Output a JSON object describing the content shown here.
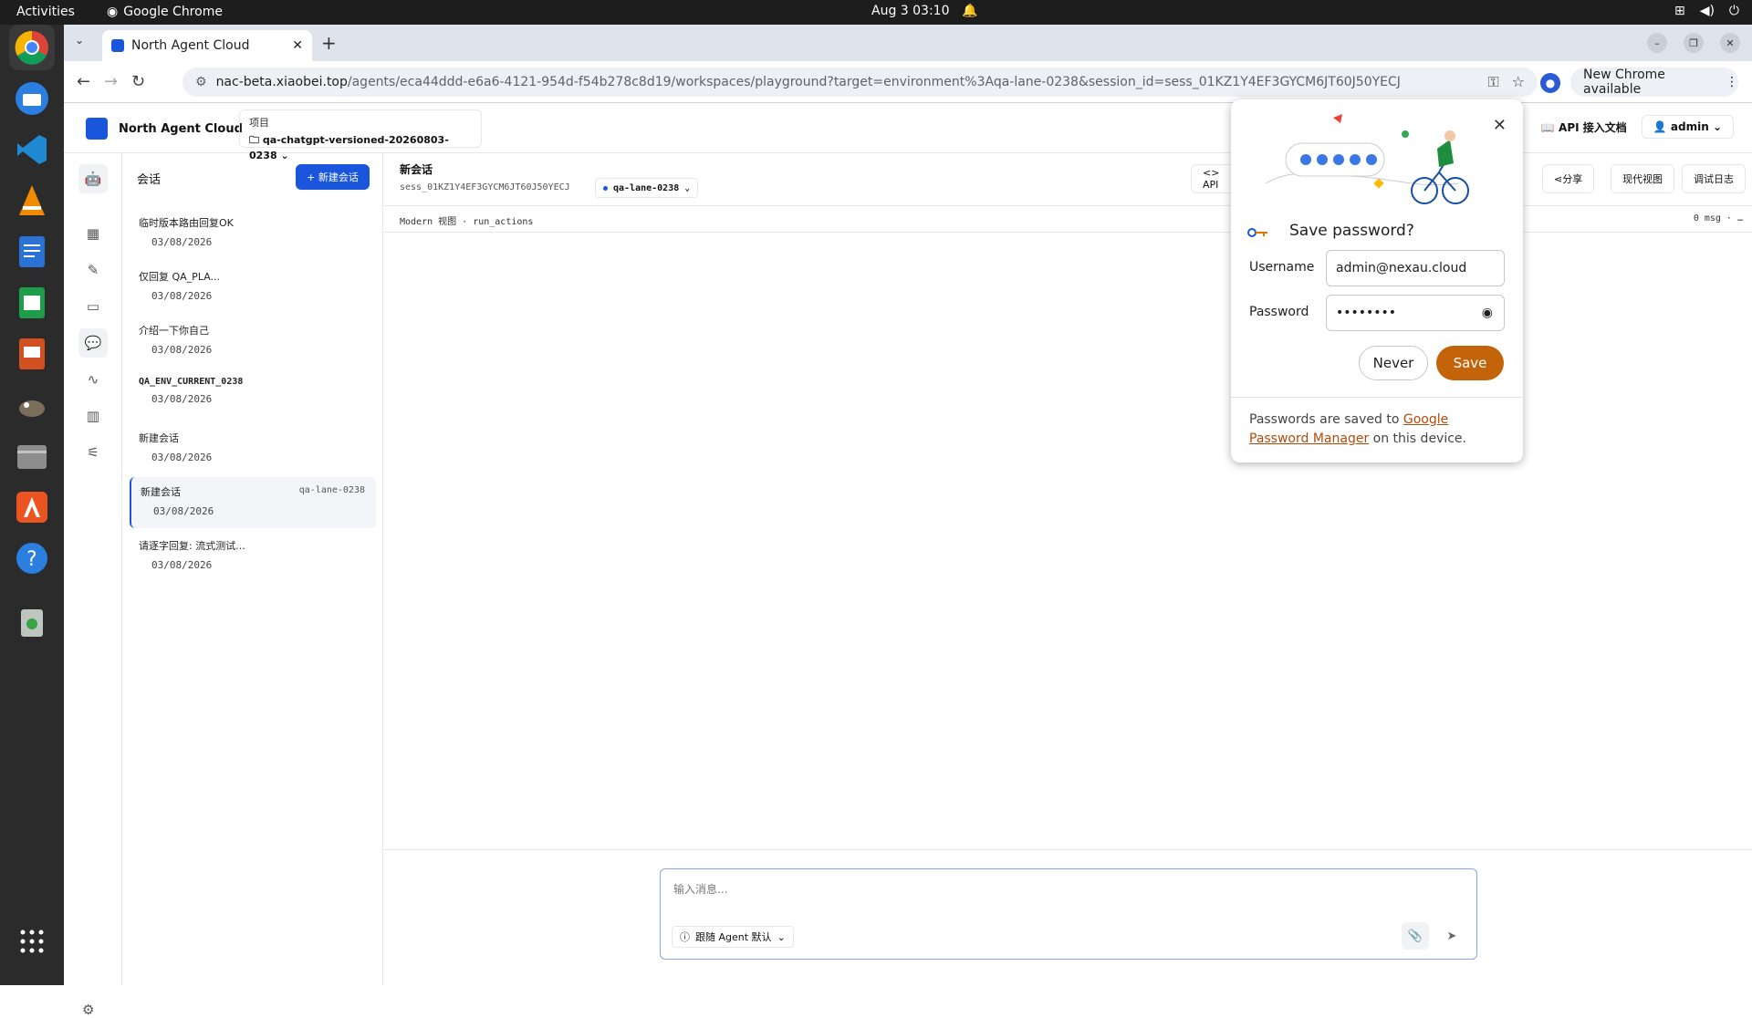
{
  "system": {
    "activities": "Activities",
    "app_name": "Google Chrome",
    "clock": "Aug 3  03:10"
  },
  "browser": {
    "tab_title": "North Agent Cloud",
    "url_host": "nac-beta.xiaobei.top",
    "url_path": "/agents/eca44ddd-e6a6-4121-954d-f54b278c8d19/workspaces/playground?target=environment%3Aqa-lane-0238&session_id=sess_01KZ1Y4EF3GYCM6JT60J50YECJ",
    "update_label": "New Chrome available"
  },
  "app": {
    "brand": "North Agent Cloud",
    "project_label": "项目",
    "project_name": "qa-chatgpt-versioned-20260803-0238",
    "api_docs": "API 接入文档",
    "user": "admin"
  },
  "sessions": {
    "title": "会话",
    "new_button": "+ 新建会话",
    "items": [
      {
        "name": "临时版本路由回复OK",
        "date": "03/08/2026",
        "tag": ""
      },
      {
        "name": "仅回复 QA_PLA...",
        "date": "03/08/2026",
        "tag": ""
      },
      {
        "name": "介绍一下你自己",
        "date": "03/08/2026",
        "tag": ""
      },
      {
        "name": "QA_ENV_CURRENT_0238",
        "date": "03/08/2026",
        "tag": ""
      },
      {
        "name": "新建会话",
        "date": "03/08/2026",
        "tag": ""
      },
      {
        "name": "新建会话",
        "date": "03/08/2026",
        "tag": "qa-lane-0238"
      },
      {
        "name": "请逐字回复: 流式测试...",
        "date": "03/08/2026",
        "tag": ""
      }
    ]
  },
  "main": {
    "title": "新会话",
    "session_id": "sess_01KZ1Y4EF3GYCM6JT60J50YECJ",
    "lane": "qa-lane-0238",
    "api_button": "<> API",
    "share_button": "分享",
    "modern_view_button": "现代视图",
    "debug_log_button": "调试日志",
    "mode_line": "Modern 视图 · run_actions",
    "msg_count": "0 msg · …"
  },
  "composer": {
    "placeholder": "输入消息...",
    "follow_label": "跟随 Agent 默认"
  },
  "password_dialog": {
    "title": "Save password?",
    "username_label": "Username",
    "username_value": "admin@nexau.cloud",
    "password_label": "Password",
    "password_value": "••••••••",
    "never_label": "Never",
    "save_label": "Save",
    "footer_pre": "Passwords are saved to ",
    "footer_link": "Google Password Manager",
    "footer_post": " on this device."
  }
}
